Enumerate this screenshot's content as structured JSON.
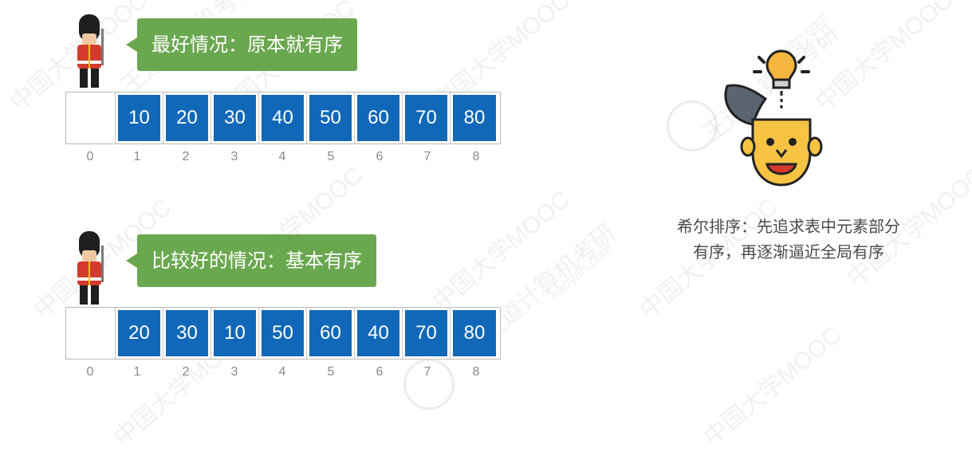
{
  "watermarks": [
    "中国大学MOOC",
    "王道计算机考研",
    "kaoyan.com"
  ],
  "scenarios": [
    {
      "label": "最好情况：原本就有序",
      "values": [
        "10",
        "20",
        "30",
        "40",
        "50",
        "60",
        "70",
        "80"
      ],
      "indices": [
        "0",
        "1",
        "2",
        "3",
        "4",
        "5",
        "6",
        "7",
        "8"
      ]
    },
    {
      "label": "比较好的情况：基本有序",
      "values": [
        "20",
        "30",
        "10",
        "50",
        "60",
        "40",
        "70",
        "80"
      ],
      "indices": [
        "0",
        "1",
        "2",
        "3",
        "4",
        "5",
        "6",
        "7",
        "8"
      ]
    }
  ],
  "caption": {
    "line1": "希尔排序：先追求表中元素部分",
    "line2": "有序，再逐渐逼近全局有序"
  },
  "colors": {
    "cell": "#1168b8",
    "bubble": "#6aa84f"
  },
  "icons": {
    "guard": "royal-guard-icon",
    "idea": "idea-head-icon"
  }
}
